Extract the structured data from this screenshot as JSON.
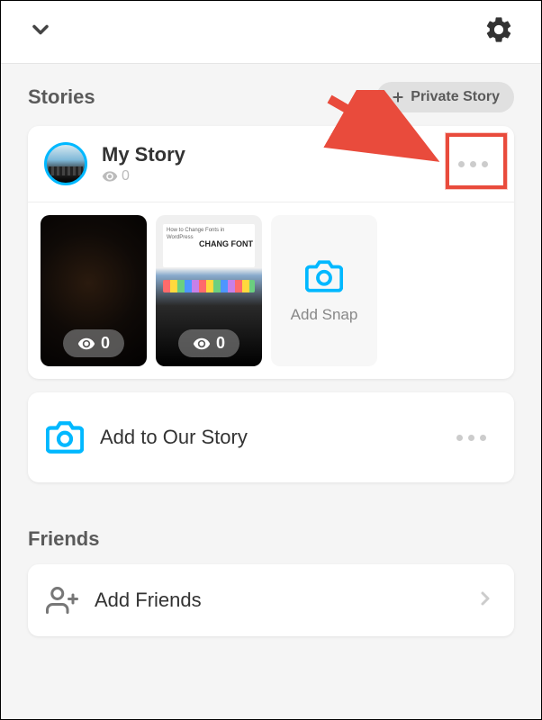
{
  "header": {},
  "sections": {
    "stories": {
      "title": "Stories",
      "private_story_btn": "Private Story"
    },
    "friends": {
      "title": "Friends"
    }
  },
  "my_story": {
    "title": "My Story",
    "view_count": "0",
    "snaps": [
      {
        "view_count": "0"
      },
      {
        "view_count": "0",
        "overlay_text_small": "How to Change Fonts in WordPress",
        "overlay_text_big": "CHANG\nFONT"
      }
    ],
    "add_snap_label": "Add Snap"
  },
  "our_story": {
    "label": "Add to Our Story"
  },
  "add_friends": {
    "label": "Add Friends"
  }
}
